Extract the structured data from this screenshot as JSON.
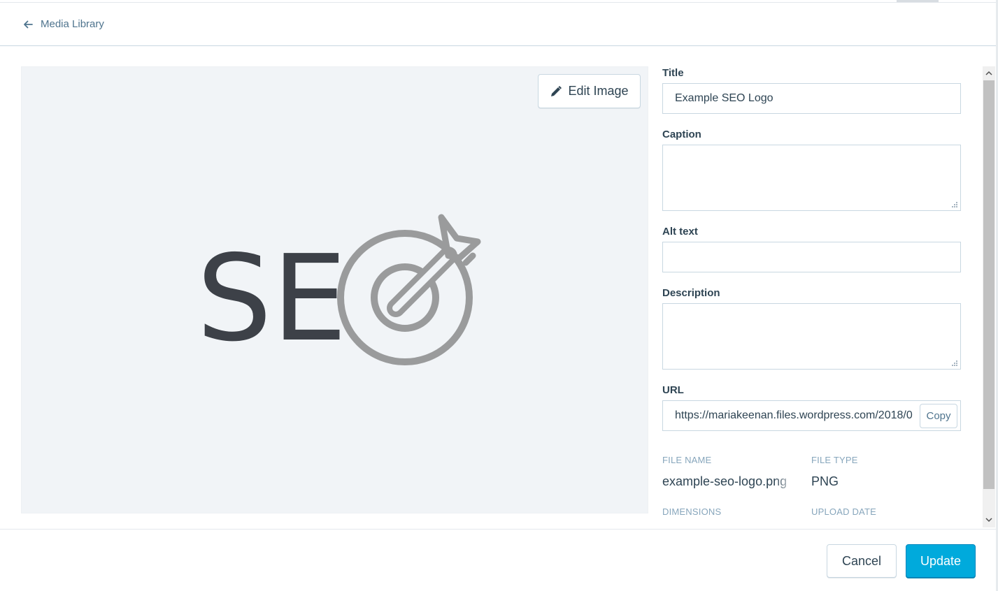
{
  "header": {
    "back_label": "Media Library"
  },
  "preview": {
    "edit_button_label": "Edit Image",
    "logo_text": "SE"
  },
  "form": {
    "title_label": "Title",
    "title_value": "Example SEO Logo",
    "caption_label": "Caption",
    "caption_value": "",
    "alt_label": "Alt text",
    "alt_value": "",
    "description_label": "Description",
    "description_value": "",
    "url_label": "URL",
    "url_value": "https://mariakeenan.files.wordpress.com/2018/0",
    "copy_label": "Copy"
  },
  "meta": {
    "file_name_label": "FILE NAME",
    "file_name_value": "example-seo-logo.png",
    "file_type_label": "FILE TYPE",
    "file_type_value": "PNG",
    "dimensions_label": "DIMENSIONS",
    "upload_date_label": "UPLOAD DATE"
  },
  "footer": {
    "cancel_label": "Cancel",
    "update_label": "Update"
  },
  "colors": {
    "primary": "#00aadc",
    "link": "#4f748e",
    "text": "#2e4453",
    "muted": "#87a6bc",
    "logo_dark": "#3d4148",
    "logo_gray": "#9a9b9c"
  }
}
